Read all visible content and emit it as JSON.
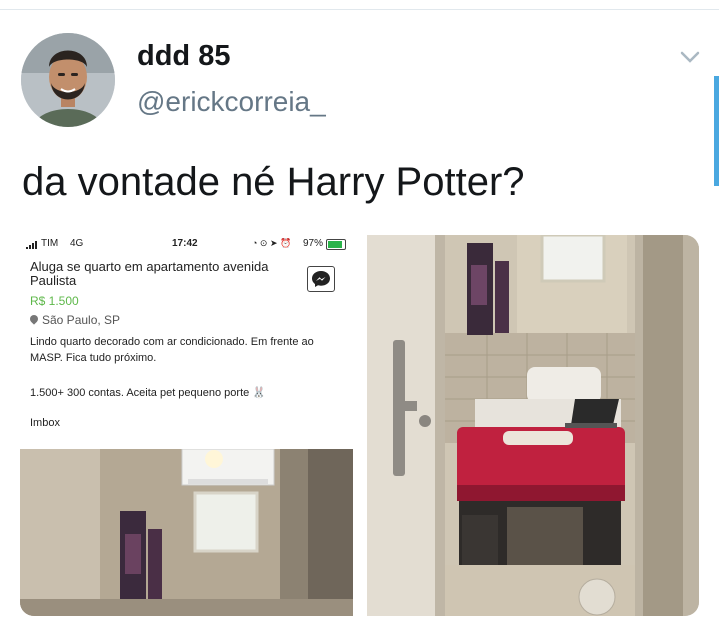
{
  "tweet": {
    "display_name": "ddd 85",
    "handle": "@erickcorreia_",
    "text": "da vontade né Harry Potter?"
  },
  "listing_screenshot": {
    "status_bar": {
      "carrier": "TIM",
      "network": "4G",
      "time": "17:42",
      "battery": "97%"
    },
    "title": "Aluga se quarto em apartamento avenida Paulista",
    "price": "R$ 1.500",
    "location": "São Paulo, SP",
    "description": "Lindo quarto decorado com ar condicionado.  Em frente ao MASP.  Fica tudo próximo.",
    "prices_line": "1.500+ 300 contas.  Aceita pet pequeno porte 🐰",
    "closing": "Imbox"
  },
  "colors": {
    "price": "#5eb84a",
    "handle": "#657786",
    "scroll_accent": "#4aa8e0",
    "bed_cover": "#c0213f"
  }
}
